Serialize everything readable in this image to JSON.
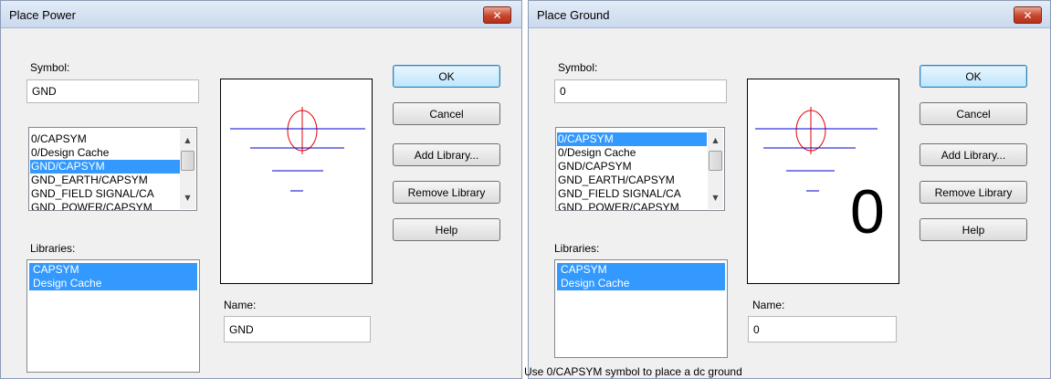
{
  "dialogs": {
    "power": {
      "title": "Place Power",
      "close_glyph": "✕",
      "symbol_label": "Symbol:",
      "symbol_value": "GND",
      "symbol_list": [
        "0/CAPSYM",
        "0/Design Cache",
        "GND/CAPSYM",
        "GND_EARTH/CAPSYM",
        "GND_FIELD SIGNAL/CA",
        "GND_POWER/CAPSYM"
      ],
      "selected_symbol": "GND/CAPSYM",
      "libraries_label": "Libraries:",
      "libraries": [
        "CAPSYM",
        "Design Cache"
      ],
      "name_label": "Name:",
      "name_value": "GND",
      "preview_text": "",
      "buttons": {
        "ok": "OK",
        "cancel": "Cancel",
        "add_library": "Add Library...",
        "remove_library": "Remove Library",
        "help": "Help"
      },
      "status": ""
    },
    "ground": {
      "title": "Place Ground",
      "close_glyph": "✕",
      "symbol_label": "Symbol:",
      "symbol_value": "0",
      "symbol_list": [
        "0/CAPSYM",
        "0/Design Cache",
        "GND/CAPSYM",
        "GND_EARTH/CAPSYM",
        "GND_FIELD SIGNAL/CA",
        "GND_POWER/CAPSYM"
      ],
      "selected_symbol": "0/CAPSYM",
      "libraries_label": "Libraries:",
      "libraries": [
        "CAPSYM",
        "Design Cache"
      ],
      "name_label": "Name:",
      "name_value": "0",
      "preview_text": "0",
      "buttons": {
        "ok": "OK",
        "cancel": "Cancel",
        "add_library": "Add Library...",
        "remove_library": "Remove Library",
        "help": "Help"
      },
      "status": "Use 0/CAPSYM symbol to place a dc ground"
    }
  },
  "colors": {
    "selection": "#3399ff",
    "symbol_lines": "#0000cc",
    "symbol_circle": "#e00000"
  }
}
